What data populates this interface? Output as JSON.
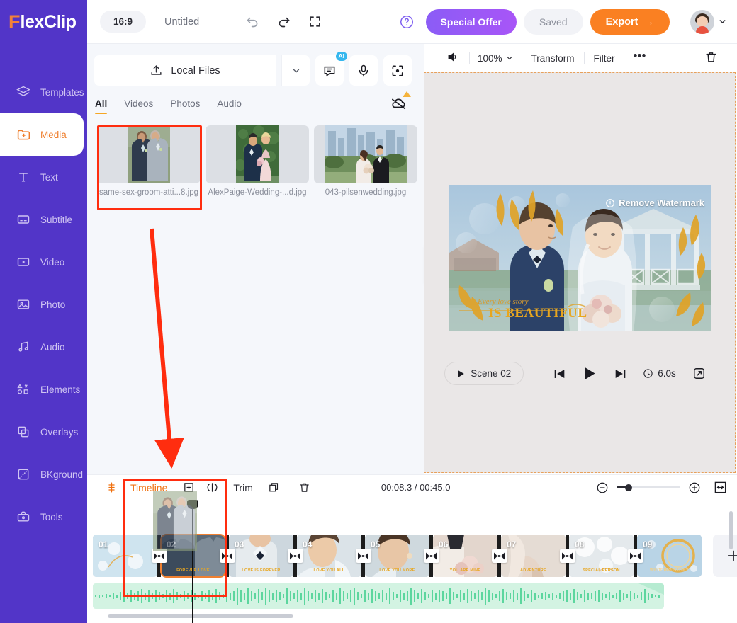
{
  "brand": {
    "logo_f": "F",
    "logo_rest": "lexClip"
  },
  "sidebar": {
    "items": [
      {
        "label": "Templates",
        "icon": "layers-icon",
        "active": false
      },
      {
        "label": "Media",
        "icon": "folder-plus-icon",
        "active": true
      },
      {
        "label": "Text",
        "icon": "text-icon",
        "active": false
      },
      {
        "label": "Subtitle",
        "icon": "subtitle-icon",
        "active": false
      },
      {
        "label": "Video",
        "icon": "video-icon",
        "active": false
      },
      {
        "label": "Photo",
        "icon": "photo-icon",
        "active": false
      },
      {
        "label": "Audio",
        "icon": "audio-note-icon",
        "active": false
      },
      {
        "label": "Elements",
        "icon": "shapes-icon",
        "active": false
      },
      {
        "label": "Overlays",
        "icon": "overlays-icon",
        "active": false
      },
      {
        "label": "BKground",
        "icon": "background-icon",
        "active": false
      },
      {
        "label": "Tools",
        "icon": "toolbox-icon",
        "active": false
      }
    ]
  },
  "topbar": {
    "ratio": "16:9",
    "project_title": "Untitled",
    "undo_icon": "undo-icon",
    "redo_icon": "redo-icon",
    "fullscreen_icon": "expand-icon",
    "help_icon": "help-circle-icon",
    "special_offer": "Special Offer",
    "saved": "Saved",
    "export": "Export",
    "export_arrow": "→",
    "avatar_caret": "chevron-down-icon"
  },
  "media_panel": {
    "upload_label": "Local Files",
    "upload_icon": "upload-icon",
    "caret_icon": "chevron-down-icon",
    "ai_badge": "AI",
    "chat_icon": "chat-ai-icon",
    "mic_icon": "microphone-icon",
    "scan_icon": "scan-record-icon",
    "cloud_icon": "cloud-off-icon",
    "tabs": [
      {
        "label": "All",
        "active": true
      },
      {
        "label": "Videos",
        "active": false
      },
      {
        "label": "Photos",
        "active": false
      },
      {
        "label": "Audio",
        "active": false
      }
    ],
    "files": [
      {
        "name": "same-sex-groom-atti...8.jpg",
        "selected": true
      },
      {
        "name": "AlexPaige-Wedding-...d.jpg",
        "selected": false
      },
      {
        "name": "043-pilsenwedding.jpg",
        "selected": false
      }
    ],
    "collapse_icon": "chevron-left-icon"
  },
  "preview": {
    "toolbar": {
      "volume_icon": "speaker-icon",
      "zoom_value": "100%",
      "zoom_caret": "chevron-down-icon",
      "transform": "Transform",
      "filter": "Filter",
      "more": "•••",
      "delete_icon": "trash-icon"
    },
    "watermark": "Remove Watermark",
    "watermark_icon": "info-circle-icon",
    "video_subtitle": "Every love story",
    "video_title": "IS BEAUTIFUL",
    "playbar": {
      "scene_label": "Scene 02",
      "play_small_icon": "play-icon",
      "prev_icon": "skip-back-icon",
      "play_icon": "play-icon",
      "next_icon": "skip-forward-icon",
      "clock_icon": "clock-icon",
      "duration": "6.0s",
      "fullscreen_icon": "expand-diagonal-icon"
    }
  },
  "timeline": {
    "mixer_icon": "mixer-icon",
    "label": "Timeline",
    "add_icon": "plus-box-icon",
    "split_icon": "split-icon",
    "trim": "Trim",
    "copy_icon": "copy-icon",
    "delete_icon": "trash-icon",
    "time": "00:08.3 / 00:45.0",
    "zoom_out_icon": "minus-circle-icon",
    "zoom_in_icon": "plus-circle-icon",
    "fit_icon": "fit-width-icon",
    "add_clip_icon": "plus-icon",
    "clips": [
      {
        "num": "01",
        "caption": "",
        "selected": false
      },
      {
        "num": "02",
        "caption": "FOREVER LOVE",
        "selected": true
      },
      {
        "num": "03",
        "caption": "LOVE IS FOREVER",
        "selected": false
      },
      {
        "num": "04",
        "caption": "LOVE YOU ALL",
        "selected": false
      },
      {
        "num": "05",
        "caption": "LOVE YOU MORE",
        "selected": false
      },
      {
        "num": "06",
        "caption": "YOU ARE MINE",
        "selected": false
      },
      {
        "num": "07",
        "caption": "ADVENTURE",
        "selected": false
      },
      {
        "num": "08",
        "caption": "SPECIAL PERSON",
        "selected": false
      },
      {
        "num": "09",
        "caption": "WEDDING STORY",
        "selected": false
      }
    ],
    "transition_icon": "transition-icon"
  },
  "annotations": {
    "arrow_color": "#ff2d0f",
    "highlight_color": "#ff2d0f",
    "media_highlight": "same-sex-groom-atti...8.jpg",
    "timeline_highlight": "drop target on timeline clip 02"
  },
  "colors": {
    "brand_purple": "#5235c8",
    "accent_orange": "#ef7f2e",
    "export_orange": "#fa8022",
    "offer_purple": "#a855f7",
    "audio_green": "#3ecf8e"
  }
}
